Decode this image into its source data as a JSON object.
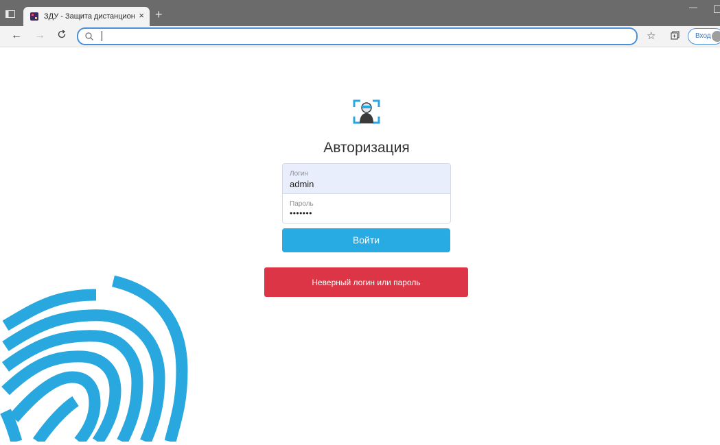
{
  "browser": {
    "tab_title": "ЗДУ - Защита дистанционного",
    "tab_close": "×",
    "new_tab": "+",
    "address_value": "",
    "signin_label": "Вход"
  },
  "login_page": {
    "heading": "Авторизация",
    "login_label": "Логин",
    "login_value": "admin",
    "password_label": "Пароль",
    "password_value": "•••••••",
    "submit_label": "Войти",
    "error_message": "Неверный логин или пароль"
  },
  "colors": {
    "accent": "#28abe2",
    "error": "#dc3545",
    "autofill": "#e8eefb"
  }
}
